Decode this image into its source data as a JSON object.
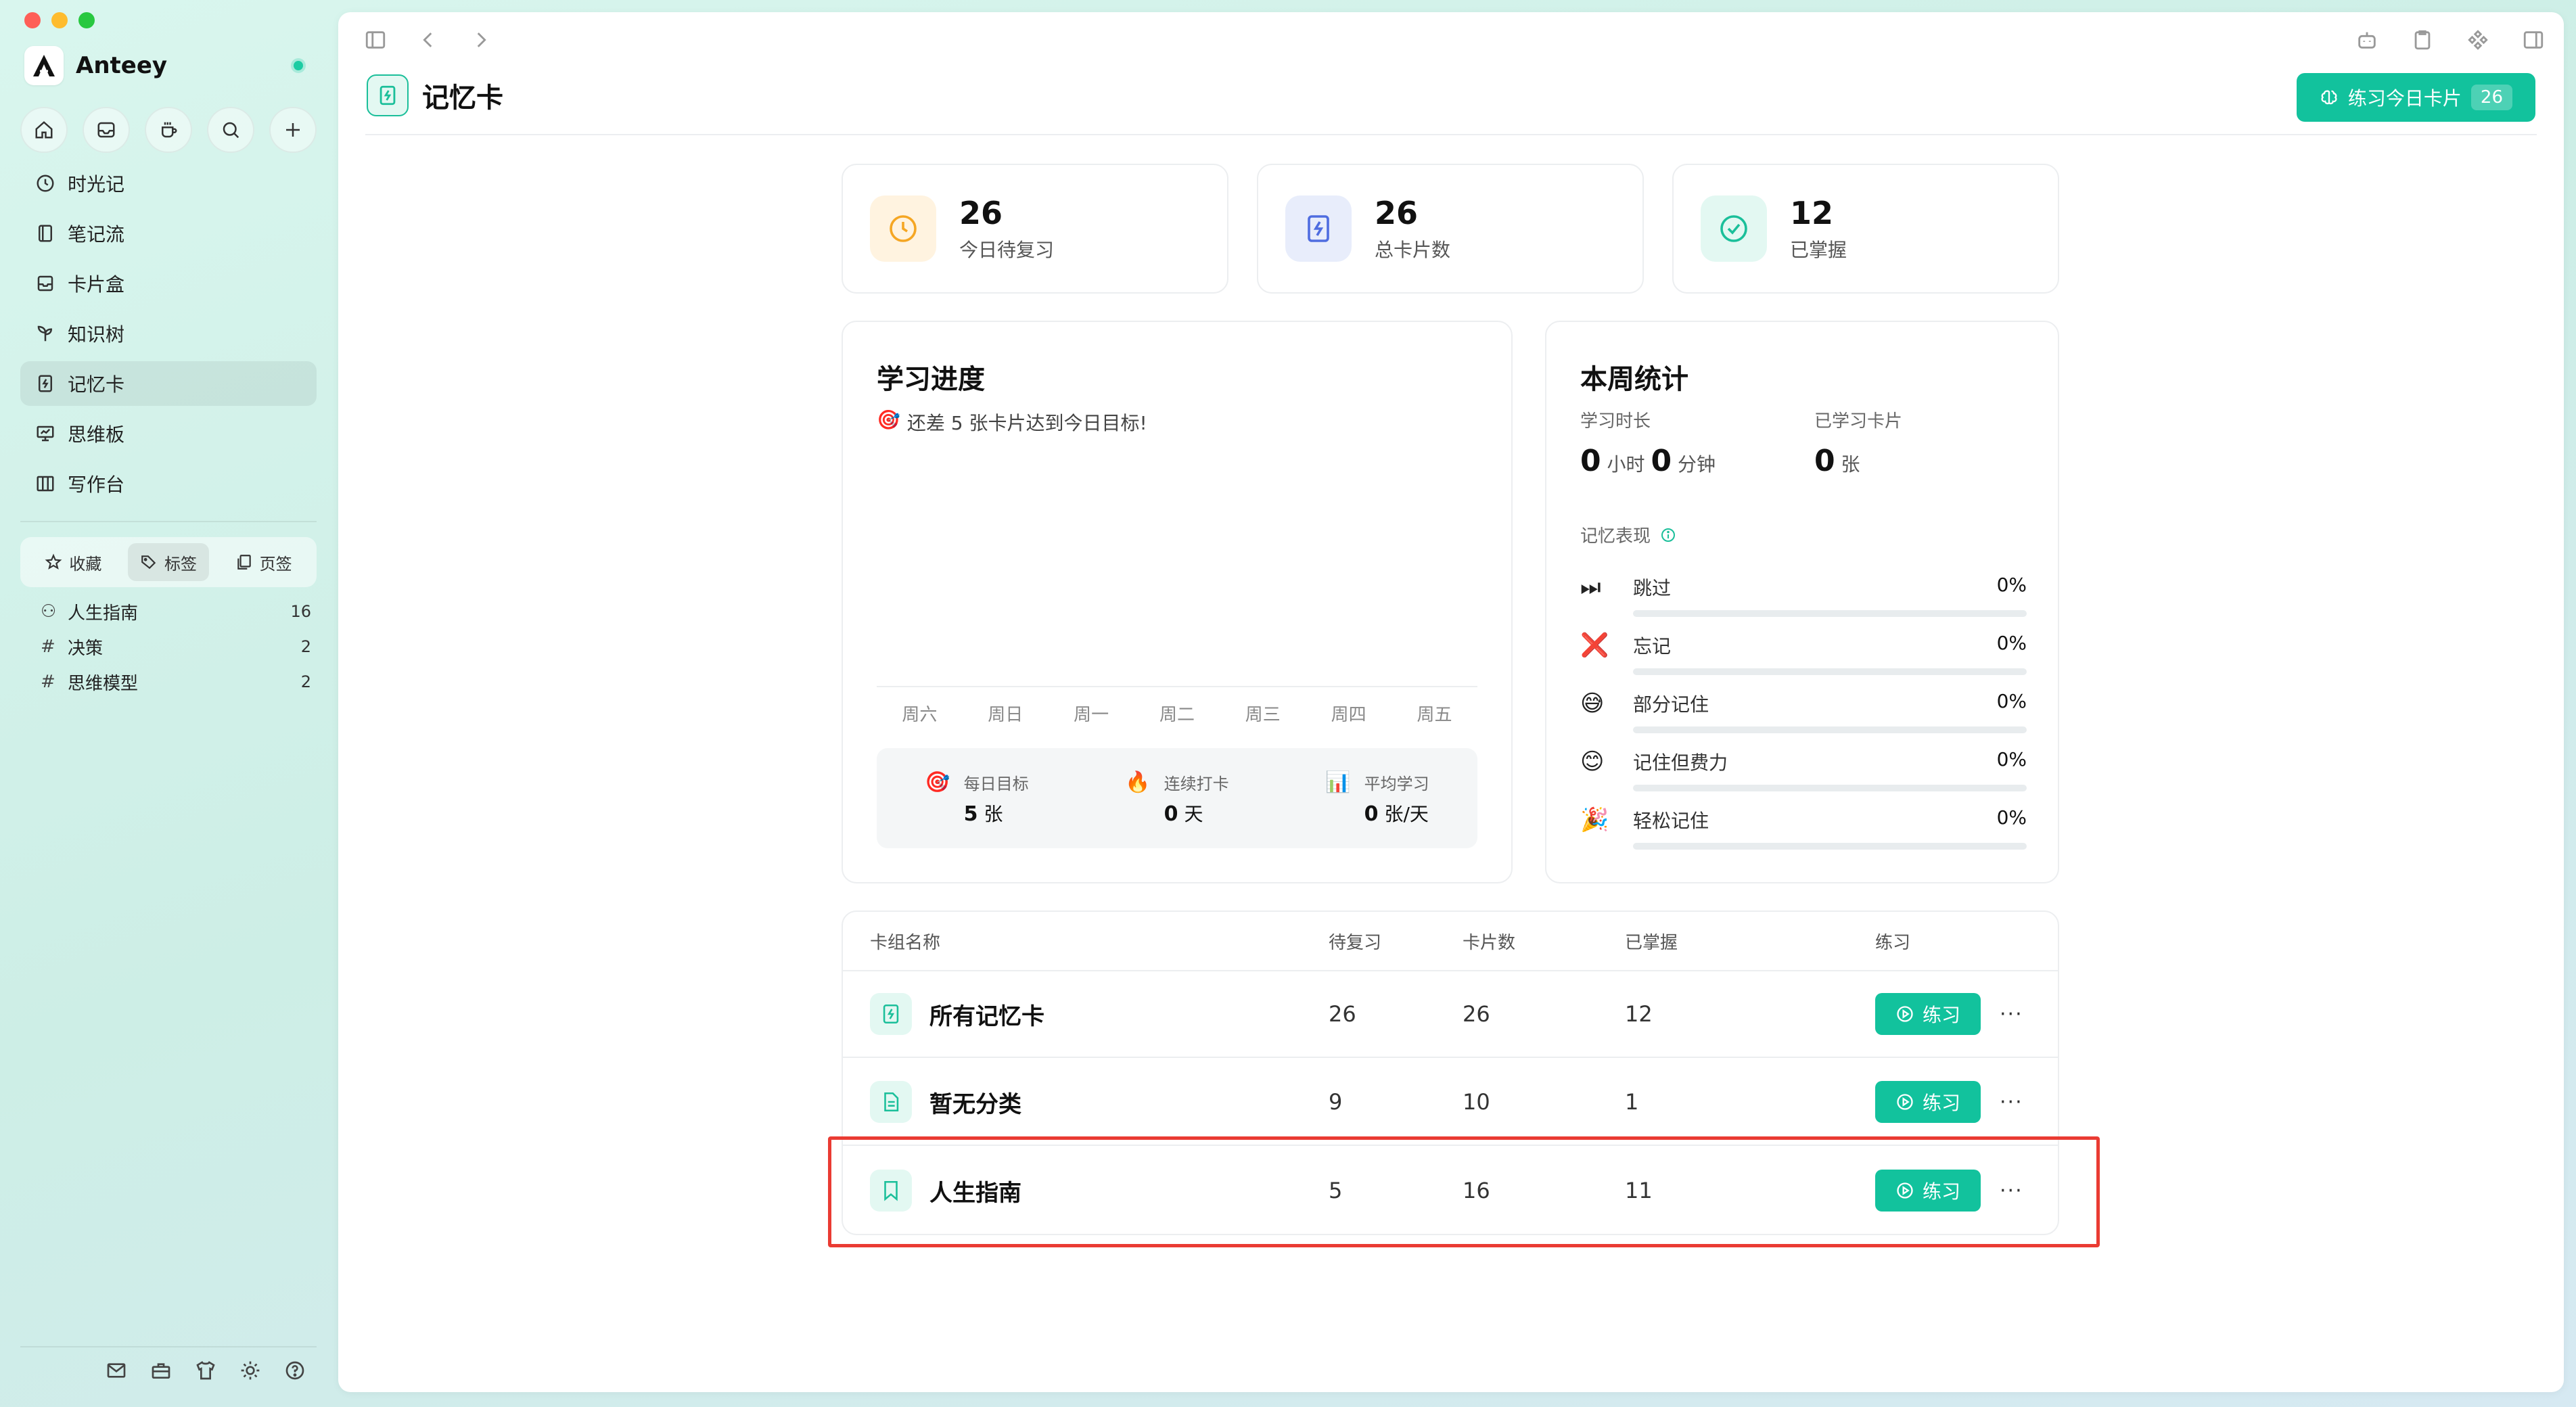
{
  "app": {
    "name": "Anteey"
  },
  "sidebar": {
    "nav": [
      {
        "label": "时光记",
        "icon": "clock-icon"
      },
      {
        "label": "笔记流",
        "icon": "notebook-icon"
      },
      {
        "label": "卡片盒",
        "icon": "inbox-icon"
      },
      {
        "label": "知识树",
        "icon": "sprout-icon"
      },
      {
        "label": "记忆卡",
        "icon": "flashcard-icon",
        "active": true
      },
      {
        "label": "思维板",
        "icon": "whiteboard-icon"
      },
      {
        "label": "写作台",
        "icon": "columns-icon"
      }
    ],
    "tabs": [
      {
        "label": "收藏",
        "icon": "star-icon"
      },
      {
        "label": "标签",
        "icon": "tag-icon",
        "active": true
      },
      {
        "label": "页签",
        "icon": "pages-icon"
      }
    ],
    "tags": [
      {
        "glyph": "⚇",
        "name": "人生指南",
        "count": "16"
      },
      {
        "glyph": "#",
        "name": "决策",
        "count": "2"
      },
      {
        "glyph": "#",
        "name": "思维模型",
        "count": "2"
      }
    ]
  },
  "header": {
    "title": "记忆卡",
    "practice_label": "练习今日卡片",
    "practice_count": "26"
  },
  "stats": [
    {
      "value": "26",
      "label": "今日待复习",
      "color": "#f5a623"
    },
    {
      "value": "26",
      "label": "总卡片数",
      "color": "#4f6de0"
    },
    {
      "value": "12",
      "label": "已掌握",
      "color": "#1bbf9a"
    }
  ],
  "progress": {
    "title": "学习进度",
    "hint": "还差 5 张卡片达到今日目标!",
    "days": [
      "周六",
      "周日",
      "周一",
      "周二",
      "周三",
      "周四",
      "周五"
    ],
    "goals": [
      {
        "emoji": "🎯",
        "label": "每日目标",
        "value": "5",
        "unit": "张"
      },
      {
        "emoji": "🔥",
        "label": "连续打卡",
        "value": "0",
        "unit": "天"
      },
      {
        "emoji": "📊",
        "label": "平均学习",
        "value": "0",
        "unit": "张/天"
      }
    ]
  },
  "weekly": {
    "title": "本周统计",
    "time_label": "学习时长",
    "hours": "0",
    "hours_unit": "小时",
    "minutes": "0",
    "minutes_unit": "分钟",
    "cards_label": "已学习卡片",
    "cards": "0",
    "cards_unit": "张",
    "memory_title": "记忆表现",
    "memory": [
      {
        "emoji": "⏭",
        "label": "跳过",
        "pct": "0%"
      },
      {
        "emoji": "❌",
        "label": "忘记",
        "pct": "0%"
      },
      {
        "emoji": "😅",
        "label": "部分记住",
        "pct": "0%"
      },
      {
        "emoji": "😊",
        "label": "记住但费力",
        "pct": "0%"
      },
      {
        "emoji": "🎉",
        "label": "轻松记住",
        "pct": "0%"
      }
    ]
  },
  "table": {
    "headers": {
      "name": "卡组名称",
      "due": "待复习",
      "cards": "卡片数",
      "mastered": "已掌握",
      "practice": "练习"
    },
    "practice_btn": "练习",
    "more": "···",
    "rows": [
      {
        "name": "所有记忆卡",
        "due": "26",
        "cards": "26",
        "mastered": "12",
        "icon": "flashcard-icon"
      },
      {
        "name": "暂无分类",
        "due": "9",
        "cards": "10",
        "mastered": "1",
        "icon": "document-icon"
      },
      {
        "name": "人生指南",
        "due": "5",
        "cards": "16",
        "mastered": "11",
        "icon": "bookmark-icon"
      }
    ]
  }
}
